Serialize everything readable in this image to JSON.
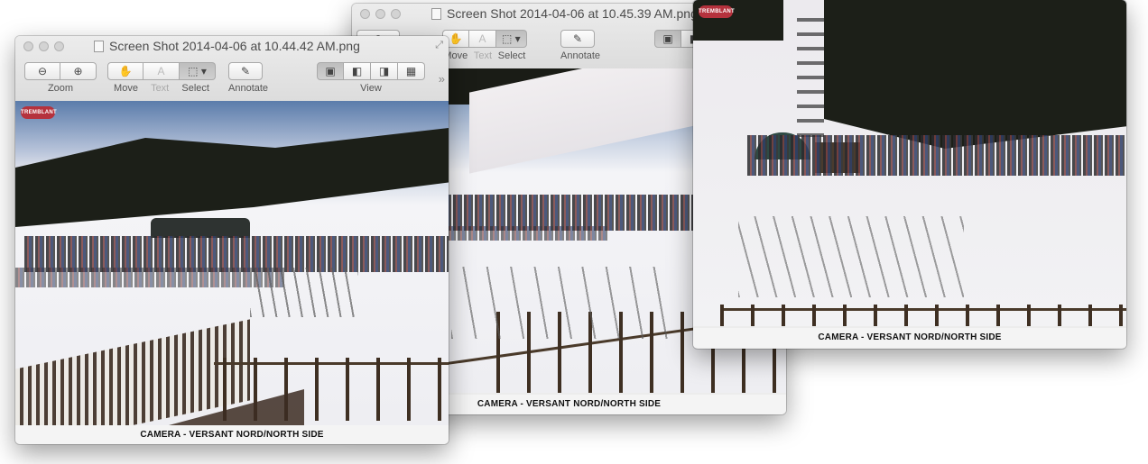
{
  "windows": [
    {
      "title": "Screen Shot 2014-04-06 at 10.44.42 AM.png",
      "toolbar": {
        "zoom_label": "Zoom",
        "zoom_out_icon": "zoom-out-icon",
        "zoom_in_icon": "zoom-in-icon",
        "move_label": "Move",
        "text_label": "Text",
        "select_label": "Select",
        "annotate_label": "Annotate",
        "view_label": "View"
      },
      "logo_text": "TREMBLANT",
      "caption": "CAMERA - VERSANT NORD/NORTH SIDE"
    },
    {
      "title": "Screen Shot 2014-04-06 at 10.45.39 AM.png",
      "toolbar": {
        "move_label": "Move",
        "text_label": "Text",
        "select_label": "Select",
        "annotate_label": "Annotate"
      },
      "caption": "CAMERA - VERSANT NORD/NORTH SIDE"
    },
    {
      "logo_text": "TREMBLANT",
      "caption": "CAMERA - VERSANT NORD/NORTH SIDE"
    }
  ],
  "colors": {
    "window_bg": "#ececec",
    "caption_text": "#111111",
    "logo_red": "#b5323d"
  }
}
